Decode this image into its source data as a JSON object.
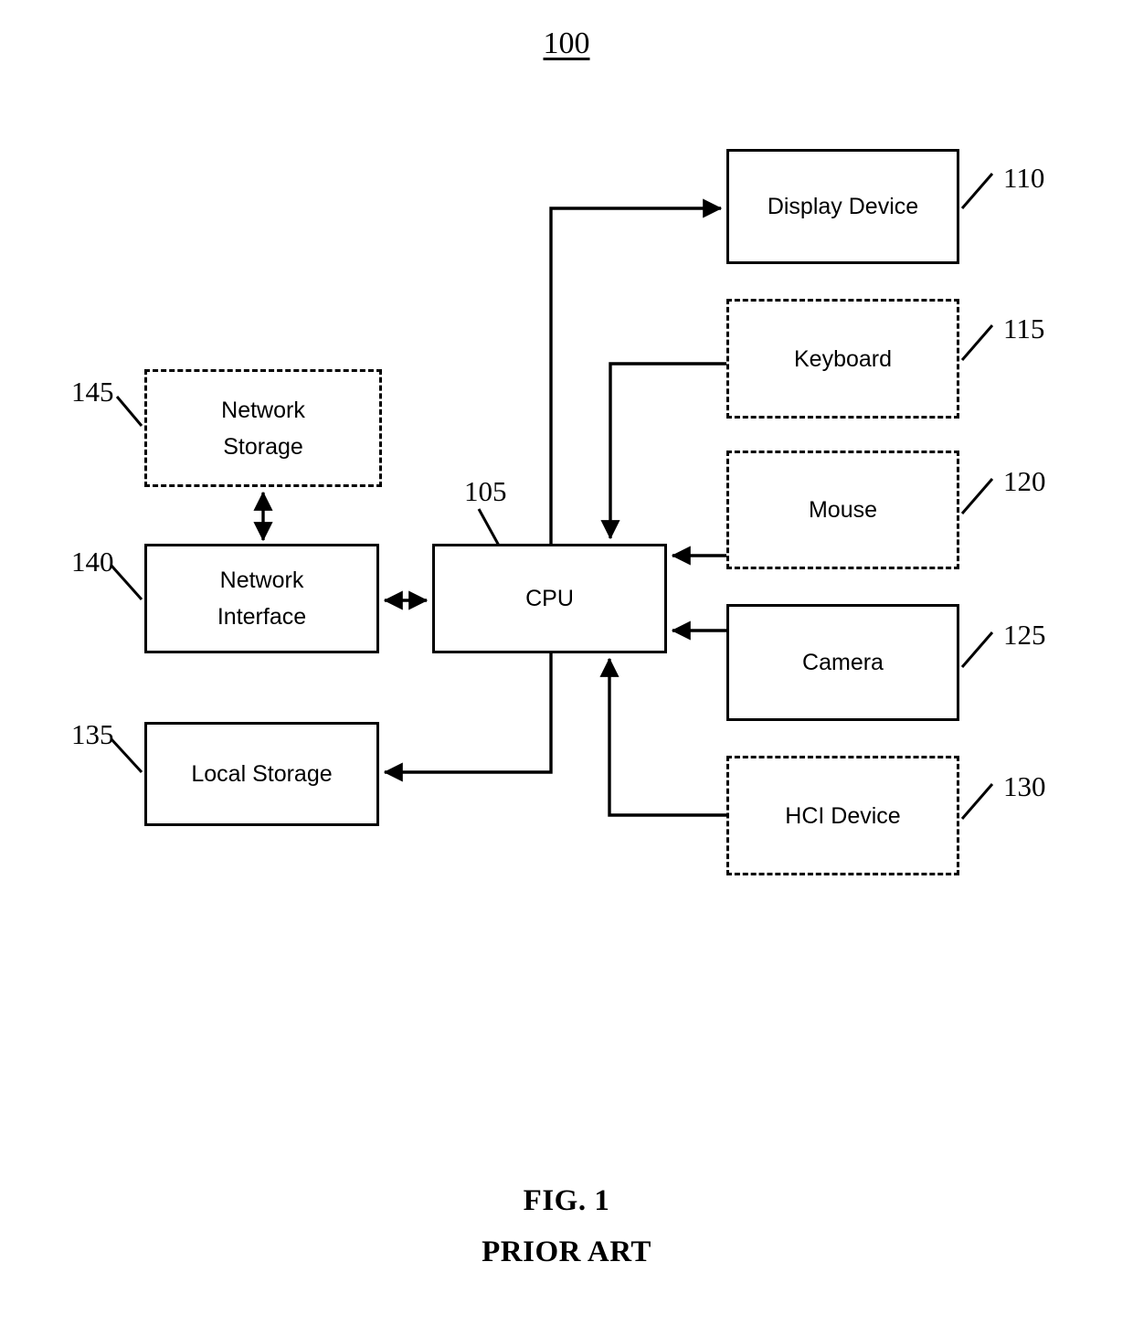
{
  "figure": {
    "number": "100",
    "caption_line1": "FIG. 1",
    "caption_line2": "PRIOR ART"
  },
  "nodes": {
    "display_device": {
      "label": "Display Device",
      "ref": "110",
      "border": "solid"
    },
    "keyboard": {
      "label": "Keyboard",
      "ref": "115",
      "border": "dashed"
    },
    "mouse": {
      "label": "Mouse",
      "ref": "120",
      "border": "dashed"
    },
    "camera": {
      "label": "Camera",
      "ref": "125",
      "border": "solid"
    },
    "hci_device": {
      "label": "HCI Device",
      "ref": "130",
      "border": "dashed"
    },
    "local_storage": {
      "label": "Local Storage",
      "ref": "135",
      "border": "solid"
    },
    "network_interface": {
      "label": "Network\nInterface",
      "ref": "140",
      "border": "solid"
    },
    "network_storage": {
      "label": "Network\nStorage",
      "ref": "145",
      "border": "dashed"
    },
    "cpu": {
      "label": "CPU",
      "ref": "105",
      "border": "solid"
    }
  },
  "connections": [
    {
      "from": "cpu",
      "to": "display_device",
      "direction": "one-way"
    },
    {
      "from": "keyboard",
      "to": "cpu",
      "direction": "one-way"
    },
    {
      "from": "mouse",
      "to": "cpu",
      "direction": "one-way"
    },
    {
      "from": "camera",
      "to": "cpu",
      "direction": "one-way"
    },
    {
      "from": "hci_device",
      "to": "cpu",
      "direction": "one-way"
    },
    {
      "from": "cpu",
      "to": "local_storage",
      "direction": "one-way"
    },
    {
      "from": "network_interface",
      "to": "cpu",
      "direction": "two-way"
    },
    {
      "from": "network_interface",
      "to": "network_storage",
      "direction": "two-way"
    }
  ],
  "colors": {
    "line": "#000000",
    "background": "#ffffff",
    "text": "#000000"
  }
}
